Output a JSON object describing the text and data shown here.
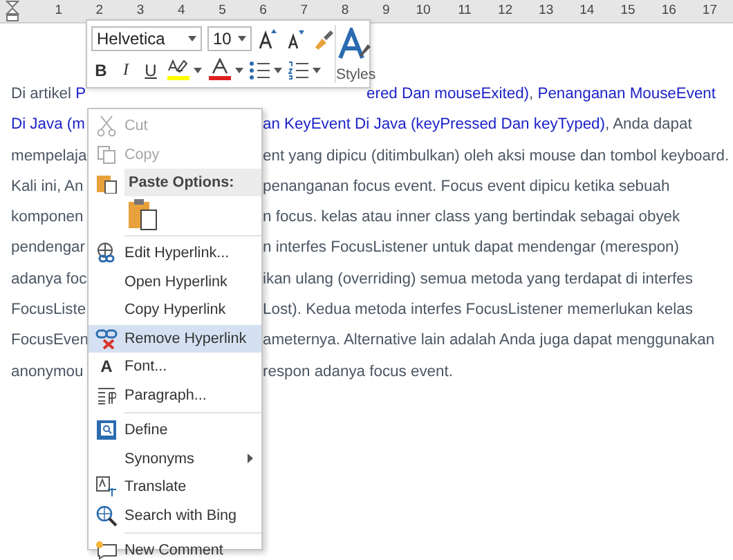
{
  "ruler": {
    "numbers": [
      "1",
      "2",
      "3",
      "4",
      "5",
      "6",
      "7",
      "8",
      "9",
      "10",
      "11",
      "12",
      "13",
      "14",
      "15",
      "16",
      "17"
    ]
  },
  "document": {
    "lines": [
      {
        "left": [
          {
            "text": "Di artikel ",
            "link": false
          },
          {
            "text": "P",
            "link": true
          }
        ],
        "right": [
          {
            "text": "ered Dan mouseExited)",
            "link": true
          },
          {
            "text": ", ",
            "link": false
          },
          {
            "text": "Penanganan MouseEvent",
            "link": true
          }
        ]
      },
      {
        "left": [
          {
            "text": "Di Java (m",
            "link": true
          }
        ],
        "right": [
          {
            "text": "an KeyEvent Di Java (keyPressed Dan keyTyped)",
            "link": true
          },
          {
            "text": ", Anda dapat",
            "link": false
          }
        ]
      },
      {
        "left": [
          {
            "text": "mempelaja",
            "link": false
          }
        ],
        "right": [
          {
            "text": "ent yang dipicu (ditimbulkan) oleh aksi mouse dan tombol keyboard.",
            "link": false
          }
        ]
      },
      {
        "left": [
          {
            "text": "Kali ini, An",
            "link": false
          }
        ],
        "right": [
          {
            "text": "penanganan focus event. Focus event dipicu ketika sebuah",
            "link": false
          }
        ]
      },
      {
        "left": [
          {
            "text": "komponen",
            "link": false
          }
        ],
        "right": [
          {
            "text": "n focus. kelas atau inner class yang bertindak sebagai obyek",
            "link": false
          }
        ]
      },
      {
        "left": [
          {
            "text": "pendengar",
            "link": false
          }
        ],
        "right": [
          {
            "text": "n interfes FocusListener untuk dapat mendengar (merespon)",
            "link": false
          }
        ]
      },
      {
        "left": [
          {
            "text": "adanya foc",
            "link": false
          }
        ],
        "right": [
          {
            "text": "ikan ulang (overriding) semua metoda yang terdapat di interfes",
            "link": false
          }
        ]
      },
      {
        "left": [
          {
            "text": "FocusListe",
            "link": false
          }
        ],
        "right": [
          {
            "text": "Lost). Kedua metoda interfes FocusListener memerlukan kelas",
            "link": false
          }
        ]
      },
      {
        "left": [
          {
            "text": "FocusEven",
            "link": false
          }
        ],
        "right": [
          {
            "text": "ameternya. Alternative lain adalah Anda juga dapat menggunakan",
            "link": false
          }
        ]
      },
      {
        "left": [
          {
            "text": "anonymou",
            "link": false
          }
        ],
        "right": [
          {
            "text": "respon adanya focus event.",
            "link": false
          }
        ]
      }
    ]
  },
  "mini_toolbar": {
    "font": "Helvetica",
    "size": "10",
    "format_buttons": [
      "B",
      "I",
      "U"
    ],
    "styles_label": "Styles"
  },
  "context_menu": {
    "items": [
      {
        "kind": "item",
        "label": "Cut",
        "disabled": true,
        "selected": false
      },
      {
        "kind": "item",
        "label": "Copy",
        "disabled": true,
        "selected": false
      },
      {
        "kind": "header",
        "label": "Paste Options:"
      },
      {
        "kind": "paste"
      },
      {
        "kind": "separator"
      },
      {
        "kind": "item",
        "label": "Edit Hyperlink...",
        "disabled": false,
        "selected": false
      },
      {
        "kind": "item",
        "label": "Open Hyperlink",
        "disabled": false,
        "selected": false
      },
      {
        "kind": "item",
        "label": "Copy Hyperlink",
        "disabled": false,
        "selected": false
      },
      {
        "kind": "item",
        "label": "Remove Hyperlink",
        "disabled": false,
        "selected": true
      },
      {
        "kind": "item",
        "glyph": "A",
        "label": "Font...",
        "disabled": false,
        "selected": false
      },
      {
        "kind": "item",
        "label": "Paragraph...",
        "disabled": false,
        "selected": false
      },
      {
        "kind": "separator"
      },
      {
        "kind": "item",
        "label": "Define",
        "disabled": false,
        "selected": false
      },
      {
        "kind": "item",
        "label": "Synonyms",
        "disabled": false,
        "selected": false,
        "submenu": true
      },
      {
        "kind": "item",
        "label": "Translate",
        "disabled": false,
        "selected": false
      },
      {
        "kind": "item",
        "label": "Search with Bing",
        "disabled": false,
        "selected": false
      },
      {
        "kind": "separator"
      },
      {
        "kind": "item",
        "label": "New Comment",
        "disabled": false,
        "selected": false
      }
    ]
  }
}
